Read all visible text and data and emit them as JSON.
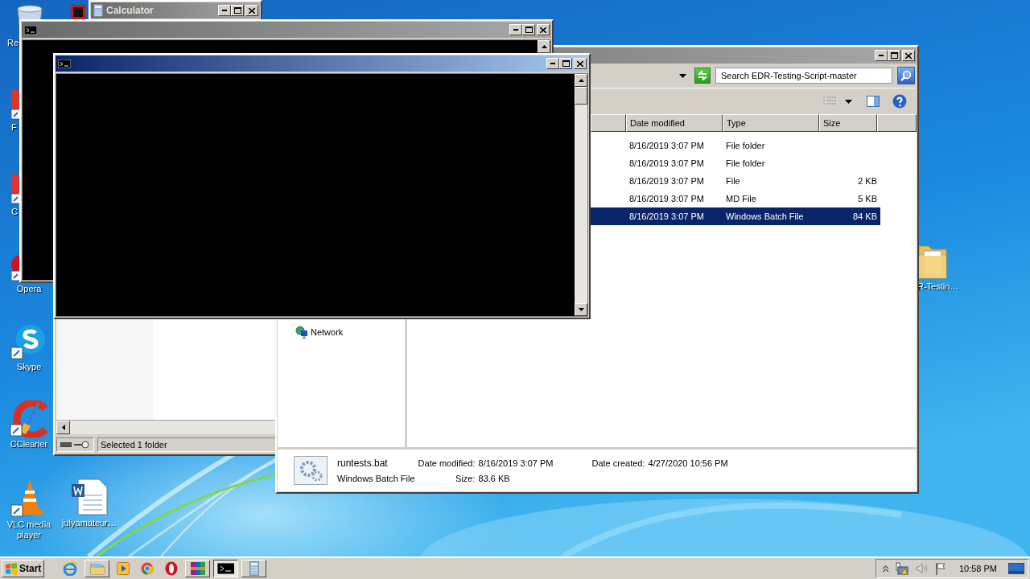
{
  "desktop_icons": [
    {
      "kind": "recycle-bin",
      "label": "Re"
    },
    {
      "kind": "app",
      "label": "F"
    },
    {
      "kind": "app",
      "label": "C"
    },
    {
      "kind": "opera",
      "label": "Opera"
    },
    {
      "kind": "skype",
      "label": "Skype"
    },
    {
      "kind": "ccleaner",
      "label": "CCleaner"
    },
    {
      "kind": "vlc",
      "label": "VLC media player"
    },
    {
      "kind": "document",
      "label": "julyamateur…"
    },
    {
      "kind": "folder",
      "label": "R-Testin…"
    }
  ],
  "calculator": {
    "title": "Calculator",
    "active": false
  },
  "consoles": [
    {
      "active": false
    },
    {
      "active": true
    }
  ],
  "back_window": {
    "status": "Selected 1 folder"
  },
  "explorer": {
    "active": false,
    "search": {
      "placeholder": "Search EDR-Testing-Script-master"
    },
    "columns": [
      "Date modified",
      "Type",
      "Size"
    ],
    "rows": [
      {
        "date": "8/16/2019 3:07 PM",
        "type": "File folder",
        "size": "",
        "selected": false
      },
      {
        "date": "8/16/2019 3:07 PM",
        "type": "File folder",
        "size": "",
        "selected": false
      },
      {
        "date": "8/16/2019 3:07 PM",
        "type": "File",
        "size": "2 KB",
        "selected": false
      },
      {
        "date": "8/16/2019 3:07 PM",
        "type": "MD File",
        "size": "5 KB",
        "selected": false
      },
      {
        "date": "8/16/2019 3:07 PM",
        "type": "Windows Batch File",
        "size": "84 KB",
        "selected": true
      }
    ],
    "nav_items": [
      {
        "label": "Network"
      }
    ],
    "details": {
      "name": "runtests.bat",
      "type": "Windows Batch File",
      "fields": [
        {
          "label": "Date modified:",
          "value": "8/16/2019 3:07 PM"
        },
        {
          "label": "Size:",
          "value": "83.6 KB"
        },
        {
          "label": "Date created:",
          "value": "4/27/2020 10:56 PM"
        }
      ]
    }
  },
  "taskbar": {
    "start": "Start",
    "clock": "10:58 PM",
    "items": [
      {
        "kind": "ie",
        "open": false,
        "selected": false
      },
      {
        "kind": "explorer",
        "open": true,
        "selected": false
      },
      {
        "kind": "media",
        "open": false,
        "selected": false
      },
      {
        "kind": "chrome",
        "open": false,
        "selected": false
      },
      {
        "kind": "opera",
        "open": false,
        "selected": false
      },
      {
        "kind": "winrar",
        "open": true,
        "selected": false
      },
      {
        "kind": "console",
        "open": true,
        "selected": true
      },
      {
        "kind": "calculator",
        "open": true,
        "selected": false
      }
    ]
  }
}
